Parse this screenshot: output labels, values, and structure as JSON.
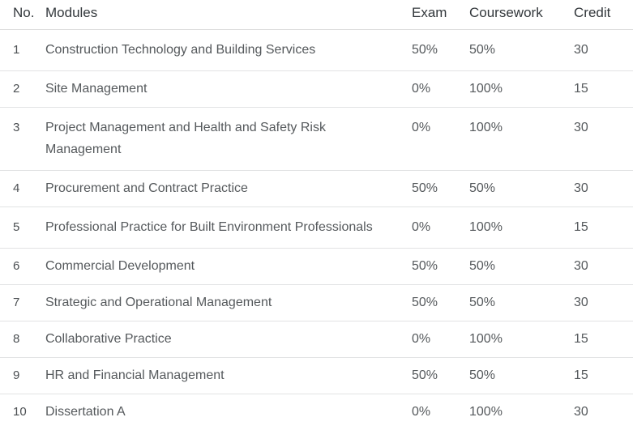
{
  "table": {
    "columns": [
      {
        "key": "no",
        "label": "No."
      },
      {
        "key": "module",
        "label": "Modules"
      },
      {
        "key": "exam",
        "label": "Exam"
      },
      {
        "key": "coursework",
        "label": "Coursework"
      },
      {
        "key": "credit",
        "label": "Credit"
      }
    ],
    "rows": [
      {
        "no": "1",
        "module": "Construction Technology and Building Services",
        "exam": "50%",
        "coursework": "50%",
        "credit": "30"
      },
      {
        "no": "2",
        "module": "Site Management",
        "exam": "0%",
        "coursework": "100%",
        "credit": "15"
      },
      {
        "no": "3",
        "module": "Project Management and Health and Safety Risk Management",
        "exam": "0%",
        "coursework": "100%",
        "credit": "30"
      },
      {
        "no": "4",
        "module": "Procurement and Contract Practice",
        "exam": "50%",
        "coursework": "50%",
        "credit": "30"
      },
      {
        "no": "5",
        "module": "Professional Practice for Built Environment Professionals",
        "exam": "0%",
        "coursework": "100%",
        "credit": "15"
      },
      {
        "no": "6",
        "module": "Commercial Development",
        "exam": "50%",
        "coursework": "50%",
        "credit": "30"
      },
      {
        "no": "7",
        "module": "Strategic and Operational Management",
        "exam": "50%",
        "coursework": "50%",
        "credit": "30"
      },
      {
        "no": "8",
        "module": "Collaborative Practice",
        "exam": "0%",
        "coursework": "100%",
        "credit": "15"
      },
      {
        "no": "9",
        "module": "HR and Financial Management",
        "exam": "50%",
        "coursework": "50%",
        "credit": "15"
      },
      {
        "no": "10",
        "module": "Dissertation A",
        "exam": "0%",
        "coursework": "100%",
        "credit": "30"
      }
    ]
  },
  "colors": {
    "background": "#ffffff",
    "header_text": "#33383c",
    "body_text": "#55595c",
    "header_rule": "#dddddd",
    "row_rule": "#e2e3e4"
  }
}
